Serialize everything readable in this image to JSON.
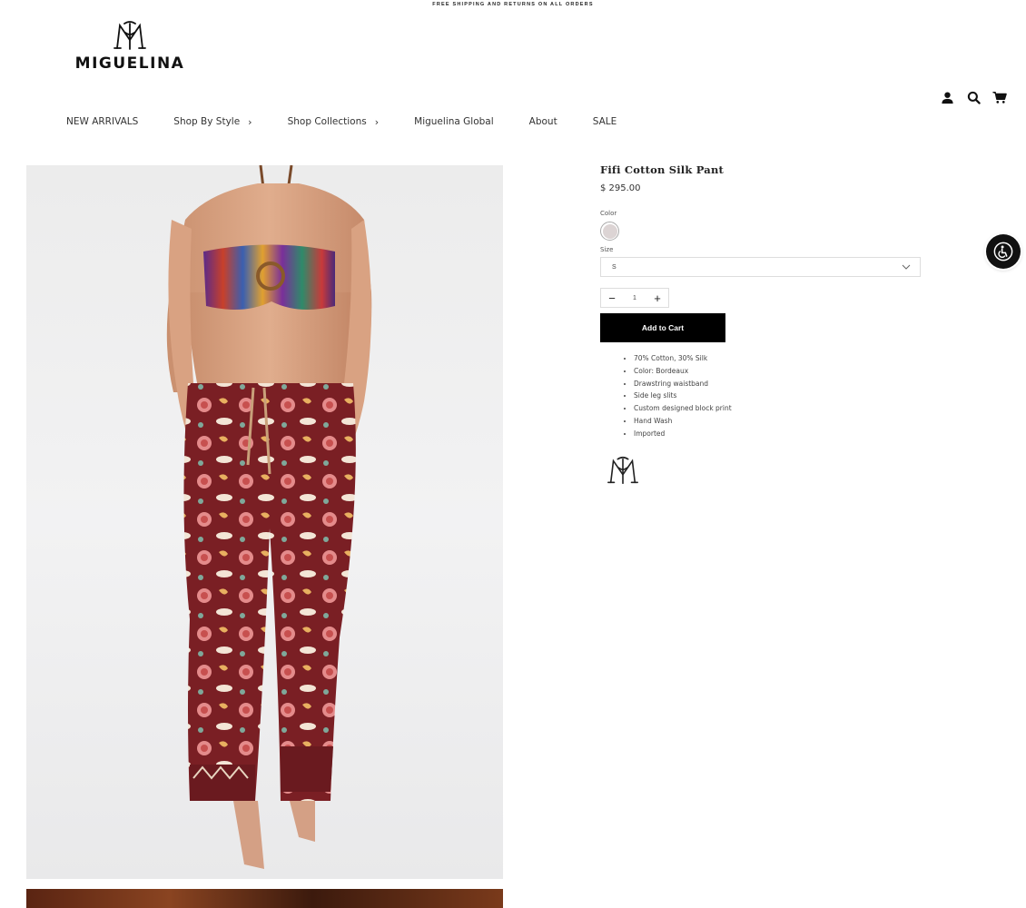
{
  "announcement": "FREE SHIPPING AND RETURNS ON ALL ORDERS",
  "brand": {
    "name": "MIGUELINA"
  },
  "nav": {
    "items": [
      {
        "label": "NEW ARRIVALS",
        "has_submenu": false
      },
      {
        "label": "Shop By Style",
        "has_submenu": true
      },
      {
        "label": "Shop Collections",
        "has_submenu": true
      },
      {
        "label": "Miguelina Global",
        "has_submenu": false
      },
      {
        "label": "About",
        "has_submenu": false
      },
      {
        "label": "SALE",
        "has_submenu": false
      }
    ]
  },
  "header_icons": [
    "account-icon",
    "search-icon",
    "cart-icon"
  ],
  "product": {
    "title": "Fifi Cotton Silk Pant",
    "price": "$ 295.00",
    "color_label": "Color",
    "swatch_color": "#dcd4d4",
    "size_label": "Size",
    "size_value": "S",
    "quantity": "1",
    "add_to_cart_label": "Add to Cart",
    "details": [
      "70% Cotton, 30% Silk",
      "Color: Bordeaux",
      "Drawstring waistband",
      "Side leg slits",
      "Custom designed block print",
      "Hand Wash",
      "Imported"
    ]
  },
  "colors": {
    "button_bg": "#000000",
    "pant_print": "#7a1f24",
    "accessibility_button": "#111111"
  }
}
